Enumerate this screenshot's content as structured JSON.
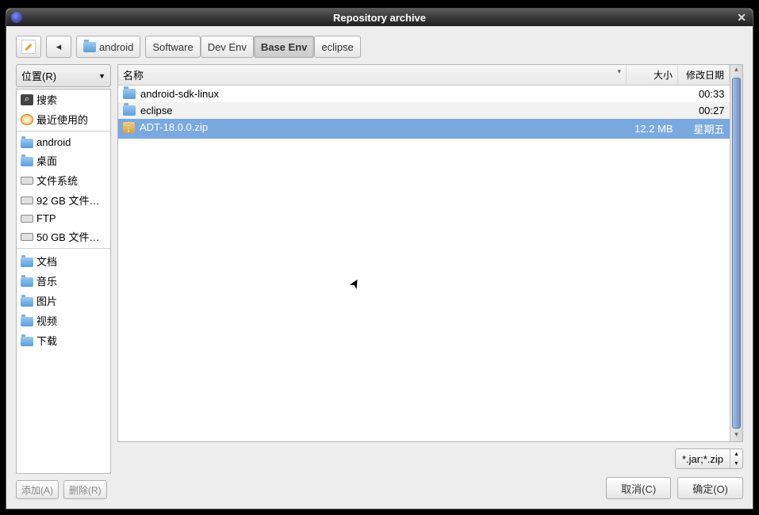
{
  "window": {
    "title": "Repository archive"
  },
  "breadcrumb": {
    "current_loc_label": "android",
    "items": [
      "Software",
      "Dev Env",
      "Base Env",
      "eclipse"
    ],
    "active_index": 2
  },
  "sidebar": {
    "places_label": "位置(R)",
    "group1": [
      {
        "icon": "search",
        "label": "搜索"
      },
      {
        "icon": "recent",
        "label": "最近使用的"
      }
    ],
    "group2": [
      {
        "icon": "folder",
        "label": "android"
      },
      {
        "icon": "folder",
        "label": "桌面"
      },
      {
        "icon": "drive",
        "label": "文件系统"
      },
      {
        "icon": "drive",
        "label": "92 GB 文件…"
      },
      {
        "icon": "drive",
        "label": "FTP"
      },
      {
        "icon": "drive",
        "label": "50 GB 文件…"
      }
    ],
    "group3": [
      {
        "icon": "folder",
        "label": "文档"
      },
      {
        "icon": "folder",
        "label": "音乐"
      },
      {
        "icon": "folder",
        "label": "图片"
      },
      {
        "icon": "folder",
        "label": "视频"
      },
      {
        "icon": "folder",
        "label": "下载"
      }
    ],
    "add_label": "添加(A)",
    "remove_label": "删除(R)"
  },
  "file_list": {
    "columns": {
      "name": "名称",
      "size": "大小",
      "date": "修改日期"
    },
    "rows": [
      {
        "type": "folder",
        "name": "android-sdk-linux",
        "size": "",
        "date": "00:33",
        "selected": false
      },
      {
        "type": "folder",
        "name": "eclipse",
        "size": "",
        "date": "00:27",
        "selected": false
      },
      {
        "type": "zip",
        "name": "ADT-18.0.0.zip",
        "size": "12.2 MB",
        "date": "星期五",
        "selected": true
      }
    ]
  },
  "filter": {
    "value": "*.jar;*.zip"
  },
  "buttons": {
    "cancel": "取消(C)",
    "ok": "确定(O)"
  }
}
